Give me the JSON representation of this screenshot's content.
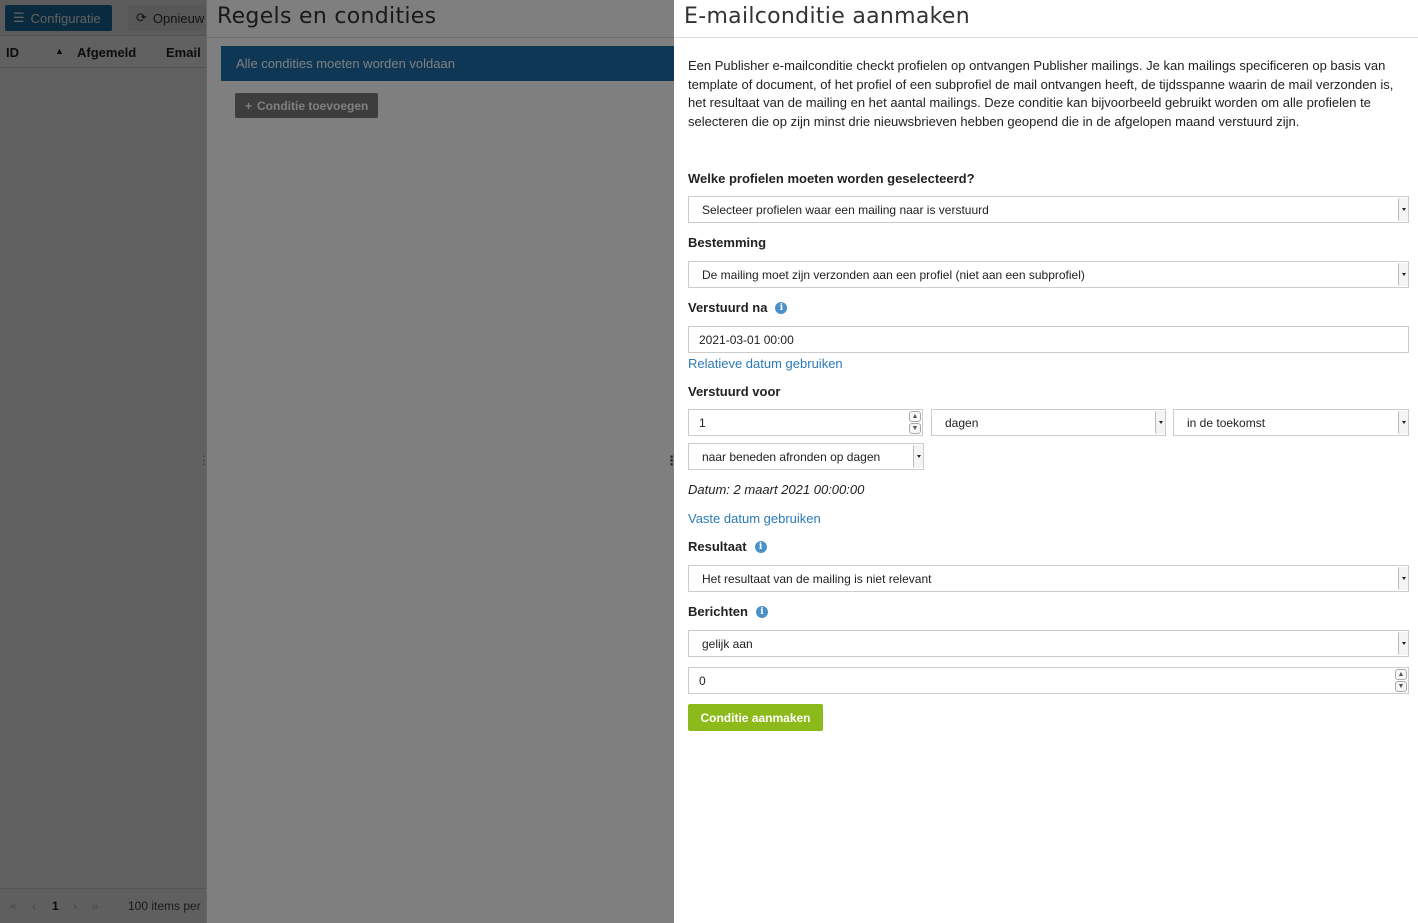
{
  "background": {
    "toolbar": {
      "configure_label": "Configuratie",
      "refresh_label": "Opnieuw"
    },
    "table": {
      "columns": [
        "ID",
        "Afgemeld",
        "Email"
      ]
    },
    "pager": {
      "current_page": "1",
      "items_per_page_label": "100 items per"
    }
  },
  "middle": {
    "title": "Regels en condities",
    "banner": "Alle condities moeten worden voldaan",
    "add_condition_label": "Conditie toevoegen"
  },
  "dialog": {
    "title": "E-mailconditie aanmaken",
    "description": "Een Publisher e-mailconditie checkt profielen op ontvangen Publisher mailings. Je kan mailings specificeren op basis van template of document, of het profiel of een subprofiel de mail ontvangen heeft, de tijdsspanne waarin de mail verzonden is, het resultaat van de mailing en het aantal mailings. Deze conditie kan bijvoorbeeld gebruikt worden om alle profielen te selecteren die op zijn minst drie nieuwsbrieven hebben geopend die in de afgelopen maand verstuurd zijn.",
    "profiles": {
      "label": "Welke profielen moeten worden geselecteerd?",
      "value": "Selecteer profielen waar een mailing naar is verstuurd"
    },
    "destination": {
      "label": "Bestemming",
      "value": "De mailing moet zijn verzonden aan een profiel (niet aan een subprofiel)"
    },
    "sent_after": {
      "label": "Verstuurd na",
      "value": "2021-03-01 00:00",
      "relative_link": "Relatieve datum gebruiken"
    },
    "sent_before": {
      "label": "Verstuurd voor",
      "amount": "1",
      "unit": "dagen",
      "direction": "in de toekomst",
      "rounding": "naar beneden afronden op dagen",
      "date_note": "Datum: 2 maart 2021 00:00:00",
      "fixed_link": "Vaste datum gebruiken"
    },
    "result": {
      "label": "Resultaat",
      "value": "Het resultaat van de mailing is niet relevant"
    },
    "messages": {
      "label": "Berichten",
      "operator": "gelijk aan",
      "count": "0"
    },
    "submit_label": "Conditie aanmaken"
  },
  "colors": {
    "primary_blue": "#1b6fa8",
    "link_blue": "#2a7ab8",
    "submit_green": "#8dba1b",
    "overlay": "rgba(0,0,0,0.5)"
  }
}
